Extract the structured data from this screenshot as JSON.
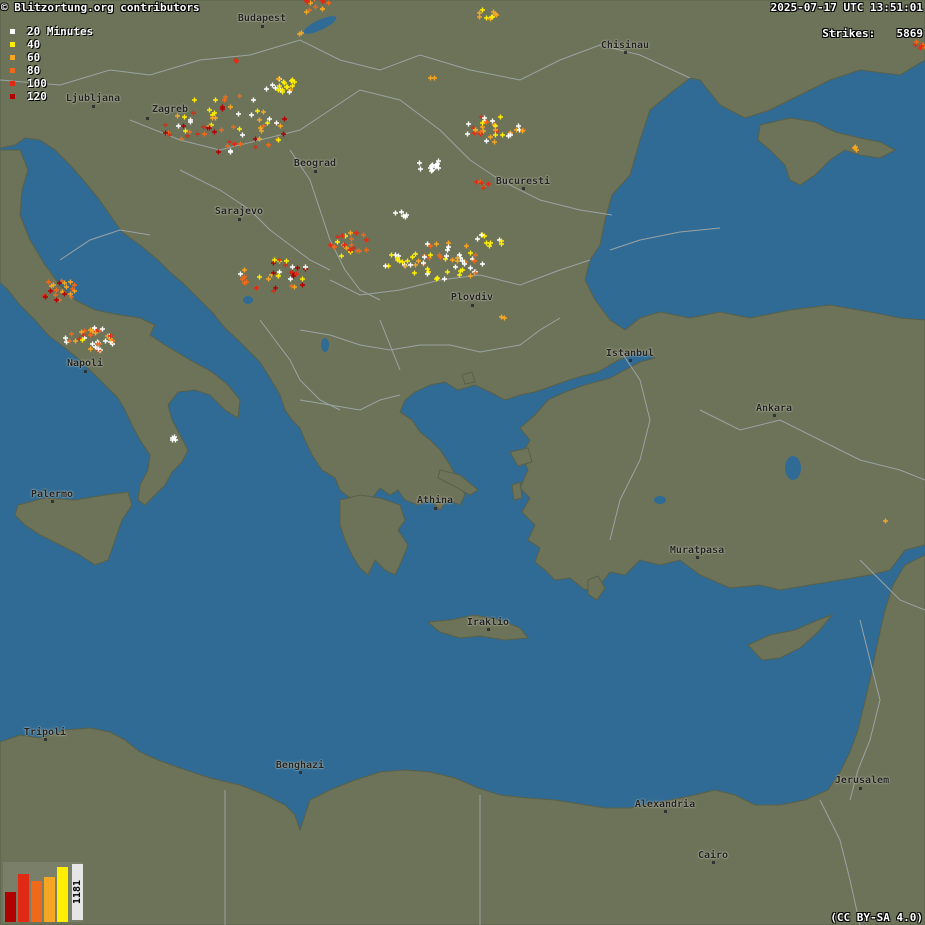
{
  "header": {
    "credit": "© Blitzortung.org contributors",
    "timestamp": "2025-07-17 UTC 13:51:01",
    "strikes_label": "Strikes:",
    "strikes_value": "5869"
  },
  "footer": {
    "license": "(CC BY-SA 4.0)"
  },
  "legend": {
    "rows": [
      {
        "value": "20",
        "unit": "Minutes",
        "color": "#ffffff"
      },
      {
        "value": "40",
        "unit": "",
        "color": "#ffee00"
      },
      {
        "value": "60",
        "unit": "",
        "color": "#f5a623"
      },
      {
        "value": "80",
        "unit": "",
        "color": "#ee6a1a"
      },
      {
        "value": "100",
        "unit": "",
        "color": "#e02a14"
      },
      {
        "value": "120",
        "unit": "",
        "color": "#b00000"
      }
    ]
  },
  "histogram": {
    "count": "1181",
    "bars": [
      {
        "level": 0.52,
        "color": "#b00000"
      },
      {
        "level": 0.82,
        "color": "#e02a14"
      },
      {
        "level": 0.7,
        "color": "#ee6a1a"
      },
      {
        "level": 0.78,
        "color": "#f5a623"
      },
      {
        "level": 0.95,
        "color": "#ffee00"
      }
    ]
  },
  "colors": {
    "sea": "#2f6b95",
    "land": "#6d7359",
    "border": "#9aa3a3"
  },
  "cities": {
    "budapest": "Budapest",
    "chisinau": "Chisinau",
    "ljubljana": "Ljubljana",
    "zagreb": "Zagreb",
    "beograd": "Beograd",
    "bucuresti": "Bucuresti",
    "sarajevo": "Sarajevo",
    "plovdiv": "Plovdiv",
    "napoli": "Napoli",
    "istanbul": "Istanbul",
    "ankara": "Ankara",
    "palermo": "Palermo",
    "athina": "Athina",
    "muratpasa": "Muratpasa",
    "iraklio": "Iraklio",
    "tripoli": "Tripoli",
    "benghazi": "Benghazi",
    "jerusalem": "Jerusalem",
    "alexandria": "Alexandria",
    "cairo": "Cairo"
  }
}
